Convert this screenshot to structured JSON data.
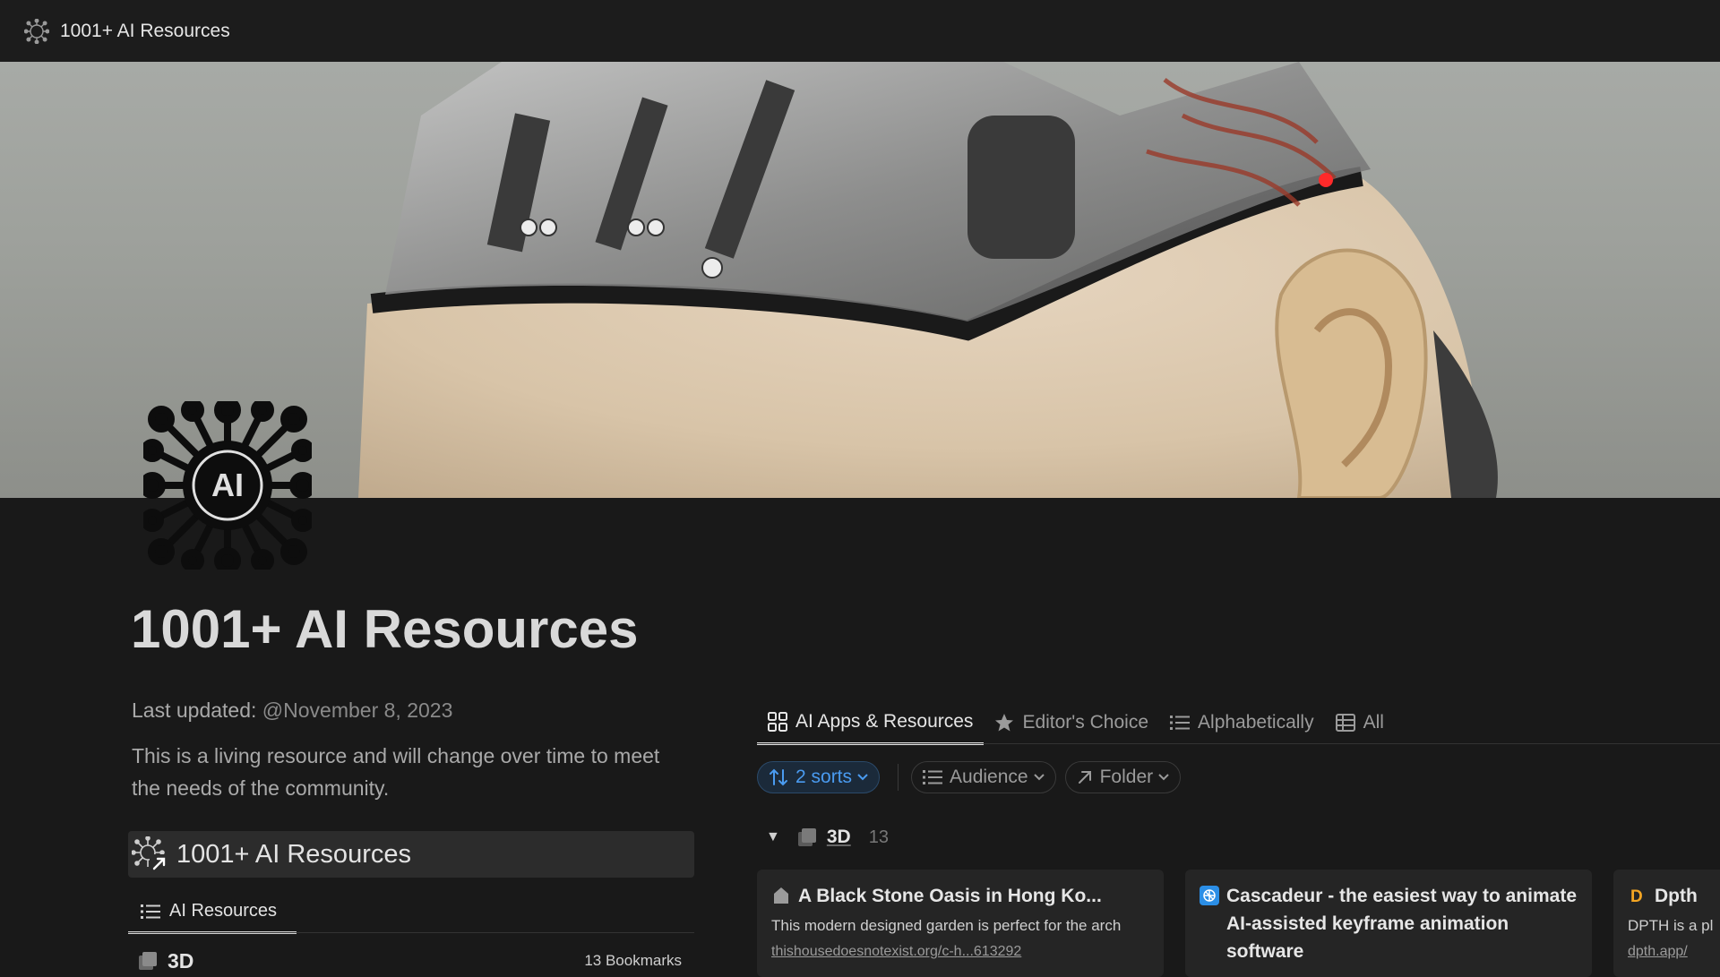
{
  "topbar": {
    "title": "1001+ AI Resources"
  },
  "page": {
    "title": "1001+ AI Resources",
    "updated_label": "Last updated:",
    "updated_date": "@November 8, 2023",
    "description": "This is a living resource and will change over time to meet the needs of the community.",
    "icon_text": "AI"
  },
  "linked_page": {
    "label": "1001+ AI Resources"
  },
  "left_view": {
    "tab_label": "AI Resources",
    "rows": [
      {
        "label": "3D",
        "count": "13 Bookmarks"
      }
    ]
  },
  "views": {
    "tabs": [
      {
        "label": "AI Apps & Resources",
        "icon": "gallery-icon",
        "active": true
      },
      {
        "label": "Editor's Choice",
        "icon": "star-icon",
        "active": false
      },
      {
        "label": "Alphabetically",
        "icon": "list-icon",
        "active": false
      },
      {
        "label": "All",
        "icon": "table-icon",
        "active": false
      }
    ]
  },
  "filters": {
    "sorts": "2 sorts",
    "audience": "Audience",
    "folder": "Folder"
  },
  "group": {
    "label": "3D",
    "count": "13"
  },
  "cards": [
    {
      "title": "A Black Stone Oasis in Hong Ko...",
      "description": "This modern designed garden is perfect for the arch",
      "url": "thishousedoesnotexist.org/c-h...613292"
    },
    {
      "title": "Cascadeur - the easiest way to animate AI-assisted keyframe animation software",
      "description": "",
      "url": ""
    },
    {
      "title": "Dpth",
      "description": "DPTH is a pl",
      "url": "dpth.app/"
    }
  ],
  "colors": {
    "background": "#191919",
    "accent_blue": "#4a9bf0",
    "card": "#252525"
  }
}
